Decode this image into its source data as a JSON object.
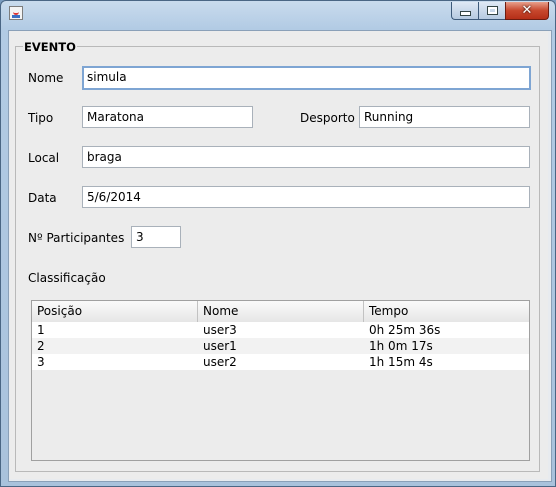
{
  "window": {
    "title": ""
  },
  "group_title": "EVENTO",
  "form": {
    "nome_label": "Nome",
    "nome_value": "simula",
    "tipo_label": "Tipo",
    "tipo_value": "Maratona",
    "desporto_label": "Desporto",
    "desporto_value": "Running",
    "local_label": "Local",
    "local_value": "braga",
    "data_label": "Data",
    "data_value": "5/6/2014",
    "participantes_label": "Nº Participantes",
    "participantes_value": "3",
    "classificacao_label": "Classificação"
  },
  "table": {
    "columns": [
      "Posição",
      "Nome",
      "Tempo"
    ],
    "rows": [
      [
        "1",
        "user3",
        "0h 25m 36s"
      ],
      [
        "2",
        "user1",
        "1h 0m 17s"
      ],
      [
        "3",
        "user2",
        "1h 15m 4s"
      ]
    ]
  }
}
